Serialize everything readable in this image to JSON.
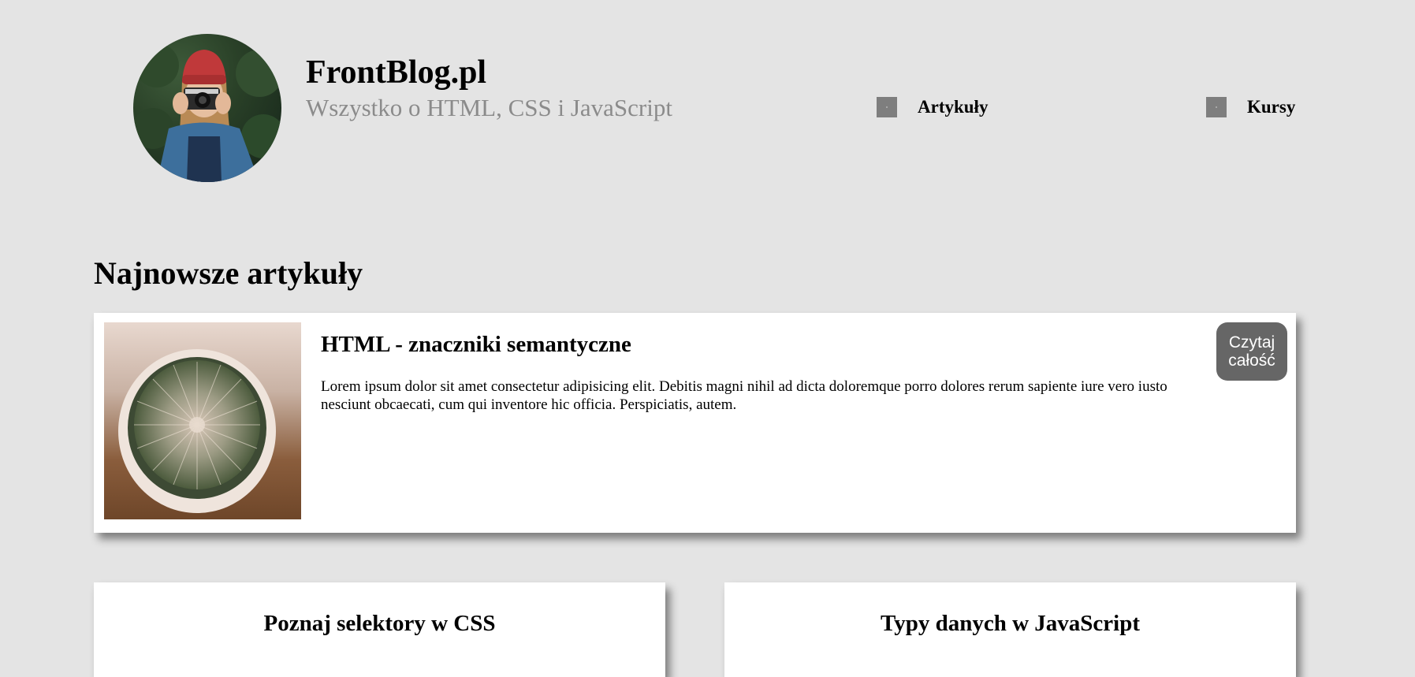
{
  "header": {
    "title": "FrontBlog.pl",
    "subtitle": "Wszystko o HTML, CSS i JavaScript",
    "nav": [
      {
        "label": "Artykuły",
        "icon": "article-icon"
      },
      {
        "label": "Kursy",
        "icon": "course-icon"
      }
    ]
  },
  "main": {
    "section_title": "Najnowsze artykuły",
    "featured": {
      "title": "HTML - znaczniki semantyczne",
      "excerpt": "Lorem ipsum dolor sit amet consectetur adipisicing elit. Debitis magni nihil ad dicta doloremque porro dolores rerum sapiente iure vero iusto nesciunt obcaecati, cum qui inventore hic officia. Perspiciatis, autem.",
      "read_more_label": "Czytaj całość"
    },
    "articles": [
      {
        "title": "Poznaj selektory w CSS"
      },
      {
        "title": "Typy danych w JavaScript"
      }
    ]
  },
  "colors": {
    "page_background": "#e4e4e4",
    "card_background": "#ffffff",
    "subtitle_gray": "#8b8b8b",
    "button_background": "#666666",
    "nav_icon": "#7e7e7e"
  }
}
